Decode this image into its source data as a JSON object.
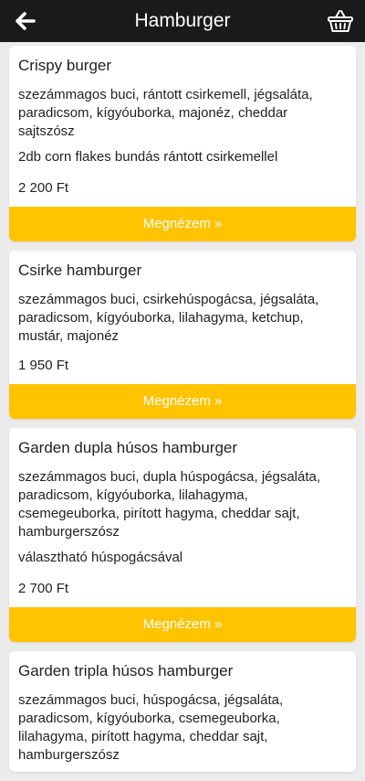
{
  "header": {
    "title": "Hamburger",
    "back_icon": "arrow-left-icon",
    "cart_icon": "basket-icon"
  },
  "colors": {
    "accent": "#ffc300",
    "topbar": "#1a1a1a",
    "background": "#ebebeb"
  },
  "products": [
    {
      "name": "Crispy burger",
      "description": "szezámmagos buci, rántott csirkemell, jégsaláta, paradicsom, kígyóuborka, majonéz, cheddar sajtszósz",
      "note": "2db corn flakes bundás rántott csirkemellel",
      "price": "2 200 Ft",
      "button_label": "Megnézem »"
    },
    {
      "name": "Csirke hamburger",
      "description": "szezámmagos buci, csirkehúspogácsa, jégsaláta, paradicsom, kígyóuborka, lilahagyma, ketchup, mustár, majonéz",
      "note": "",
      "price": "1 950 Ft",
      "button_label": "Megnézem »"
    },
    {
      "name": "Garden dupla húsos hamburger",
      "description": "szezámmagos buci, dupla húspogácsa, jégsaláta, paradicsom, kígyóuborka, lilahagyma, csemegeuborka, pirított hagyma, cheddar sajt, hamburgerszósz",
      "note": "választható húspogácsával",
      "price": "2 700 Ft",
      "button_label": "Megnézem »"
    },
    {
      "name": "Garden tripla húsos hamburger",
      "description": "szezámmagos buci, húspogácsa, jégsaláta, paradicsom, kígyóuborka, csemegeuborka, lilahagyma, pirított hagyma, cheddar sajt, hamburgerszósz",
      "note": "",
      "price": "",
      "button_label": ""
    }
  ]
}
